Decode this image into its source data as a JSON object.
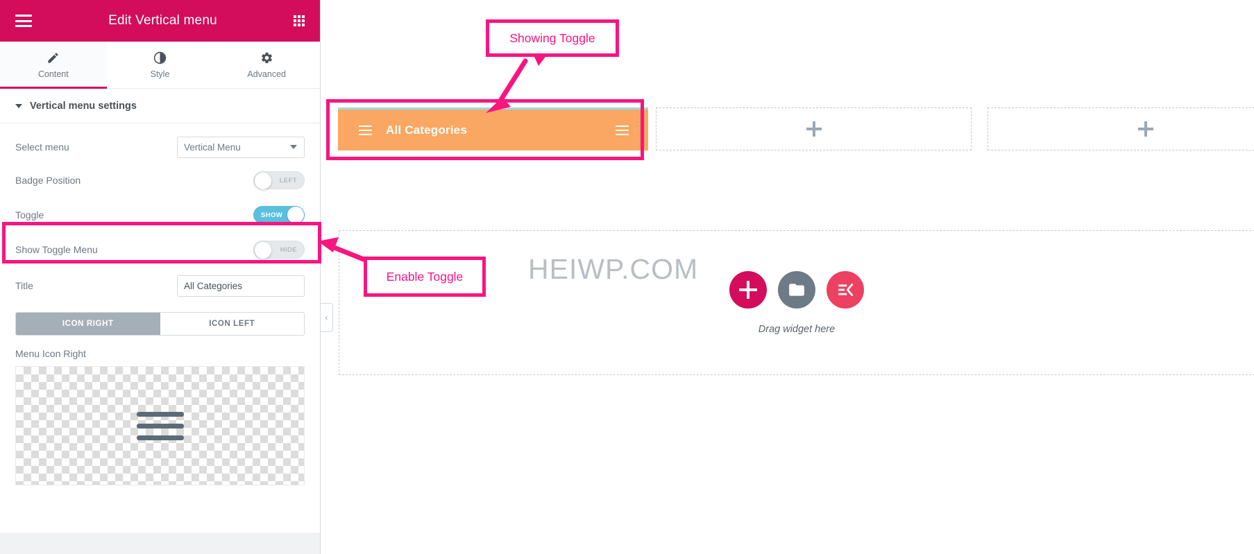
{
  "panel": {
    "header": {
      "title": "Edit Vertical menu",
      "menu_icon": "hamburger-icon",
      "apps_icon": "grid-apps-icon"
    },
    "tabs": [
      {
        "label": "Content",
        "icon": "pencil-icon",
        "active": true
      },
      {
        "label": "Style",
        "icon": "contrast-icon",
        "active": false
      },
      {
        "label": "Advanced",
        "icon": "gear-icon",
        "active": false
      }
    ],
    "section": {
      "title": "Vertical menu settings",
      "caret": "chevron-down-icon"
    },
    "controls": {
      "select_menu": {
        "label": "Select menu",
        "value": "Vertical Menu",
        "caret": "chevron-down-icon"
      },
      "badge_position": {
        "label": "Badge Position",
        "state": "LEFT",
        "on": false
      },
      "toggle": {
        "label": "Toggle",
        "state": "SHOW",
        "on": true
      },
      "show_toggle_menu": {
        "label": "Show Toggle Menu",
        "state": "HIDE",
        "on": false
      },
      "title": {
        "label": "Title",
        "value": "All Categories",
        "placeholder": "All Categories"
      },
      "icon_position": {
        "options": [
          "ICON RIGHT",
          "ICON LEFT"
        ],
        "selected": "ICON RIGHT"
      },
      "menu_icon_right": {
        "label": "Menu Icon Right",
        "preview_icon": "hamburger-icon"
      }
    },
    "collapse_handle": "‹"
  },
  "canvas": {
    "menu_widget": {
      "title": "All Categories",
      "left_icon": "hamburger-icon",
      "right_icon": "hamburger-icon",
      "background_color": "#f9a762",
      "top_border_color": "#9fd8e8"
    },
    "empty_columns": [
      {
        "icon": "plus-icon"
      },
      {
        "icon": "plus-icon"
      }
    ],
    "dropzone": {
      "caption": "Drag widget here",
      "buttons": [
        {
          "name": "add-widget-button",
          "icon": "plus-icon",
          "color": "#d30c5c"
        },
        {
          "name": "add-template-button",
          "icon": "folder-icon",
          "color": "#6e7b86"
        },
        {
          "name": "add-kit-button",
          "icon": "elementor-kit-icon",
          "color": "#ec4160"
        }
      ]
    },
    "watermark": "HEIWP.COM"
  },
  "annotations": {
    "accent_color": "#f8157f",
    "callouts": [
      {
        "id": "showing-toggle",
        "text": "Showing Toggle"
      },
      {
        "id": "enable-toggle",
        "text": "Enable Toggle"
      }
    ]
  }
}
